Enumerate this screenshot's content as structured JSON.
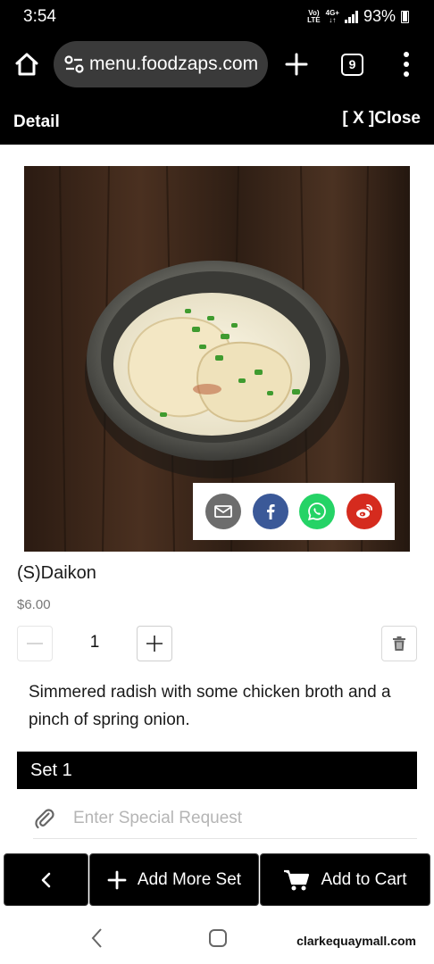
{
  "status_bar": {
    "time": "3:54",
    "network_top": "Vo)",
    "network_bottom": "LTE",
    "data_top": "4G+",
    "battery": "93%"
  },
  "browser": {
    "url": "menu.foodzaps.com",
    "tab_count": "9",
    "icons": [
      "home-icon",
      "site-settings-icon",
      "plus-icon",
      "tabs-icon",
      "more-vert-icon"
    ]
  },
  "header": {
    "title": "Detail",
    "close_label": "[ X ]Close"
  },
  "share": {
    "icons": [
      "email-icon",
      "facebook-icon",
      "whatsapp-icon",
      "weibo-icon"
    ],
    "colors": {
      "email": "#6d6d6d",
      "facebook": "#3b5998",
      "whatsapp": "#25d366",
      "weibo": "#d52b1e"
    }
  },
  "item": {
    "name": "(S)Daikon",
    "price": "$6.00",
    "quantity": "1",
    "description": "Simmered radish with some chicken broth and a pinch of spring onion."
  },
  "set": {
    "label": "Set 1",
    "request_placeholder": "Enter Special Request"
  },
  "actions": {
    "add_more_set": "Add More Set",
    "add_to_cart": "Add to Cart"
  },
  "watermark": "clarkequaymall.com"
}
